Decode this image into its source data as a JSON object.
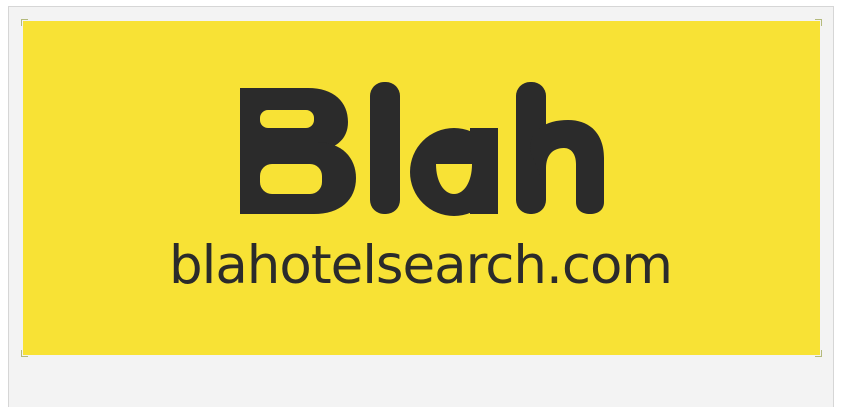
{
  "banner": {
    "background_color": "#f8e235",
    "ink_color": "#2b2b2b"
  },
  "logo": {
    "wordmark": "Blah",
    "icon": "blah-wordmark-logo"
  },
  "domain_text": "blahotelsearch.com"
}
